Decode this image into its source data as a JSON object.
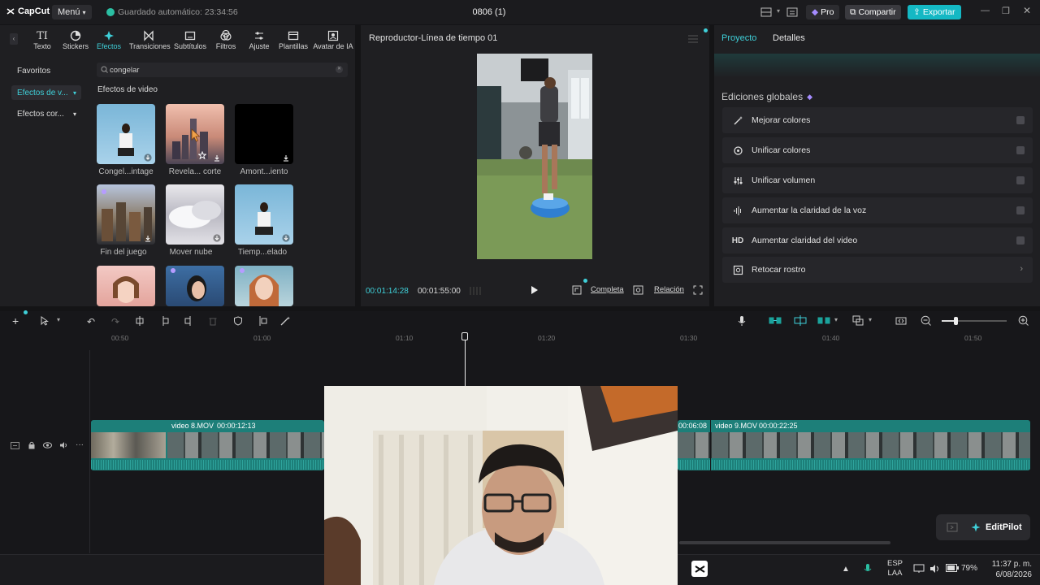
{
  "app": {
    "logo": "CapCut",
    "menu_label": "Menú",
    "autosave": "Guardado automático: 23:34:56",
    "project_title": "0806 (1)",
    "pro_label": "Pro",
    "share_label": "Compartir",
    "export_label": "Exportar"
  },
  "toolbar": {
    "items": [
      {
        "label": "Texto",
        "icon": "text-icon"
      },
      {
        "label": "Stickers",
        "icon": "sticker-icon"
      },
      {
        "label": "Efectos",
        "icon": "effects-icon",
        "active": true
      },
      {
        "label": "Transiciones",
        "icon": "transition-icon"
      },
      {
        "label": "Subtítulos",
        "icon": "subtitles-icon"
      },
      {
        "label": "Filtros",
        "icon": "filters-icon"
      },
      {
        "label": "Ajuste",
        "icon": "adjust-icon"
      },
      {
        "label": "Plantillas",
        "icon": "templates-icon"
      },
      {
        "label": "Avatar de IA",
        "icon": "avatar-icon"
      }
    ]
  },
  "sidebar": {
    "items": [
      {
        "label": "Favoritos"
      },
      {
        "label": "Efectos de v..."
      },
      {
        "label": "Efectos cor..."
      }
    ]
  },
  "search": {
    "value": "congelar"
  },
  "effects": {
    "section_title": "Efectos de video",
    "items": [
      {
        "label": "Congel...intage"
      },
      {
        "label": "Revela... corte"
      },
      {
        "label": "Amont...iento"
      },
      {
        "label": "Fin del juego"
      },
      {
        "label": "Mover nube"
      },
      {
        "label": "Tiemp...elado"
      }
    ]
  },
  "player": {
    "title": "Reproductor-Línea de tiempo 01",
    "current_time": "00:01:14:28",
    "total_time": "00:01:55:00",
    "full_label": "Completa",
    "ratio_label": "Relación"
  },
  "right_panel": {
    "tab_project": "Proyecto",
    "tab_details": "Detalles",
    "heading": "Ediciones globales",
    "options": [
      {
        "label": "Mejorar colores",
        "icon": "enhance-colors-icon"
      },
      {
        "label": "Unificar colores",
        "icon": "unify-colors-icon"
      },
      {
        "label": "Unificar volumen",
        "icon": "unify-volume-icon"
      },
      {
        "label": "Aumentar la claridad de la voz",
        "icon": "voice-clarity-icon"
      },
      {
        "label": "Aumentar claridad del video",
        "icon": "hd-icon",
        "icon_text": "HD"
      },
      {
        "label": "Retocar rostro",
        "icon": "face-retouch-icon"
      }
    ]
  },
  "timeline": {
    "ruler": [
      "00:50",
      "01:00",
      "01:10",
      "01:20",
      "01:30",
      "01:40",
      "01:50"
    ],
    "clip1_label": "video 8.MOV",
    "clip1_duration": "00:00:12:13",
    "clip2_start": "00:06:08",
    "clip2_label": "video 9.MOV",
    "clip2_duration": "00:00:22:25"
  },
  "editpilot": {
    "label": "EditPilot"
  },
  "taskbar": {
    "lang1": "ESP",
    "lang2": "LAA",
    "battery": "79%",
    "time": "11:37 p. m.",
    "date": "6/08/2026"
  },
  "colors": {
    "accent": "#3fd0d9",
    "export": "#14b8c4",
    "clip": "#1d7f79"
  }
}
